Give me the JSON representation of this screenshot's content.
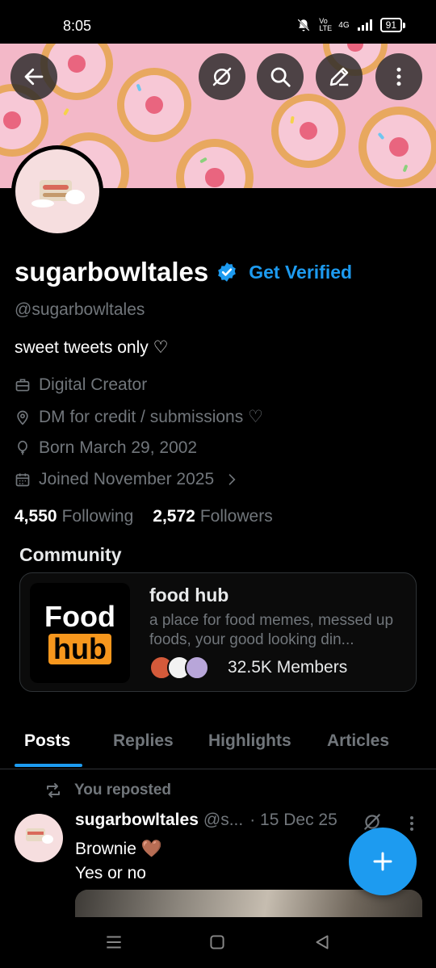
{
  "status_bar": {
    "time": "8:05",
    "network": "4G",
    "volte": "Vo LTE",
    "battery": "91"
  },
  "header": {
    "back_icon": "arrow-left-icon",
    "grok_icon": "grok-slash-icon",
    "search_icon": "search-icon",
    "edit_icon": "pencil-icon",
    "more_icon": "vertical-dots-icon"
  },
  "profile": {
    "display_name": "sugarbowltales",
    "get_verified": "Get Verified",
    "handle": "@sugarbowltales",
    "bio": "sweet tweets only ♡",
    "category": "Digital Creator",
    "location": "DM for credit / submissions ♡",
    "birthday": "Born March 29, 2002",
    "joined": "Joined November 2025",
    "following_count": "4,550",
    "following_label": "Following",
    "followers_count": "2,572",
    "followers_label": "Followers"
  },
  "community": {
    "section_title": "Community",
    "logo_top": "Food",
    "logo_bottom": "hub",
    "name": "food hub",
    "description": "a place for food memes, messed up foods, your good looking din...",
    "members": "32.5K Members"
  },
  "tabs": [
    {
      "label": "Posts",
      "active": true
    },
    {
      "label": "Replies",
      "active": false
    },
    {
      "label": "Highlights",
      "active": false
    },
    {
      "label": "Articles",
      "active": false
    }
  ],
  "post": {
    "repost_label": "You reposted",
    "author": "sugarbowltales",
    "handle_trunc": "@s...",
    "date": "· 15 Dec 25",
    "line1": "Brownie 🤎",
    "line2": "Yes or no"
  },
  "colors": {
    "accent": "#1d9bf0",
    "background": "#000000",
    "muted": "#71767b",
    "hub_orange": "#f7971d"
  }
}
